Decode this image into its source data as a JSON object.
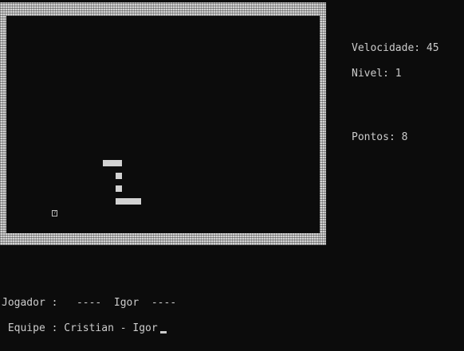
{
  "game": {
    "speed_label": "Velocidade:",
    "speed_value": "45",
    "level_label": "Nivel:",
    "level_value": "1",
    "score_label": "Pontos:",
    "score_value": "8",
    "food_glyph": "?"
  },
  "footer": {
    "player_label": "Jogador :",
    "player_name": "----  Igor  ----",
    "team_label": " Equipe :",
    "team_members": "Cristian - Igor"
  },
  "colors": {
    "background": "#0c0c0c",
    "foreground": "#cccccc",
    "wall": "#d4d4d4",
    "snake": "#d2d2d2"
  }
}
